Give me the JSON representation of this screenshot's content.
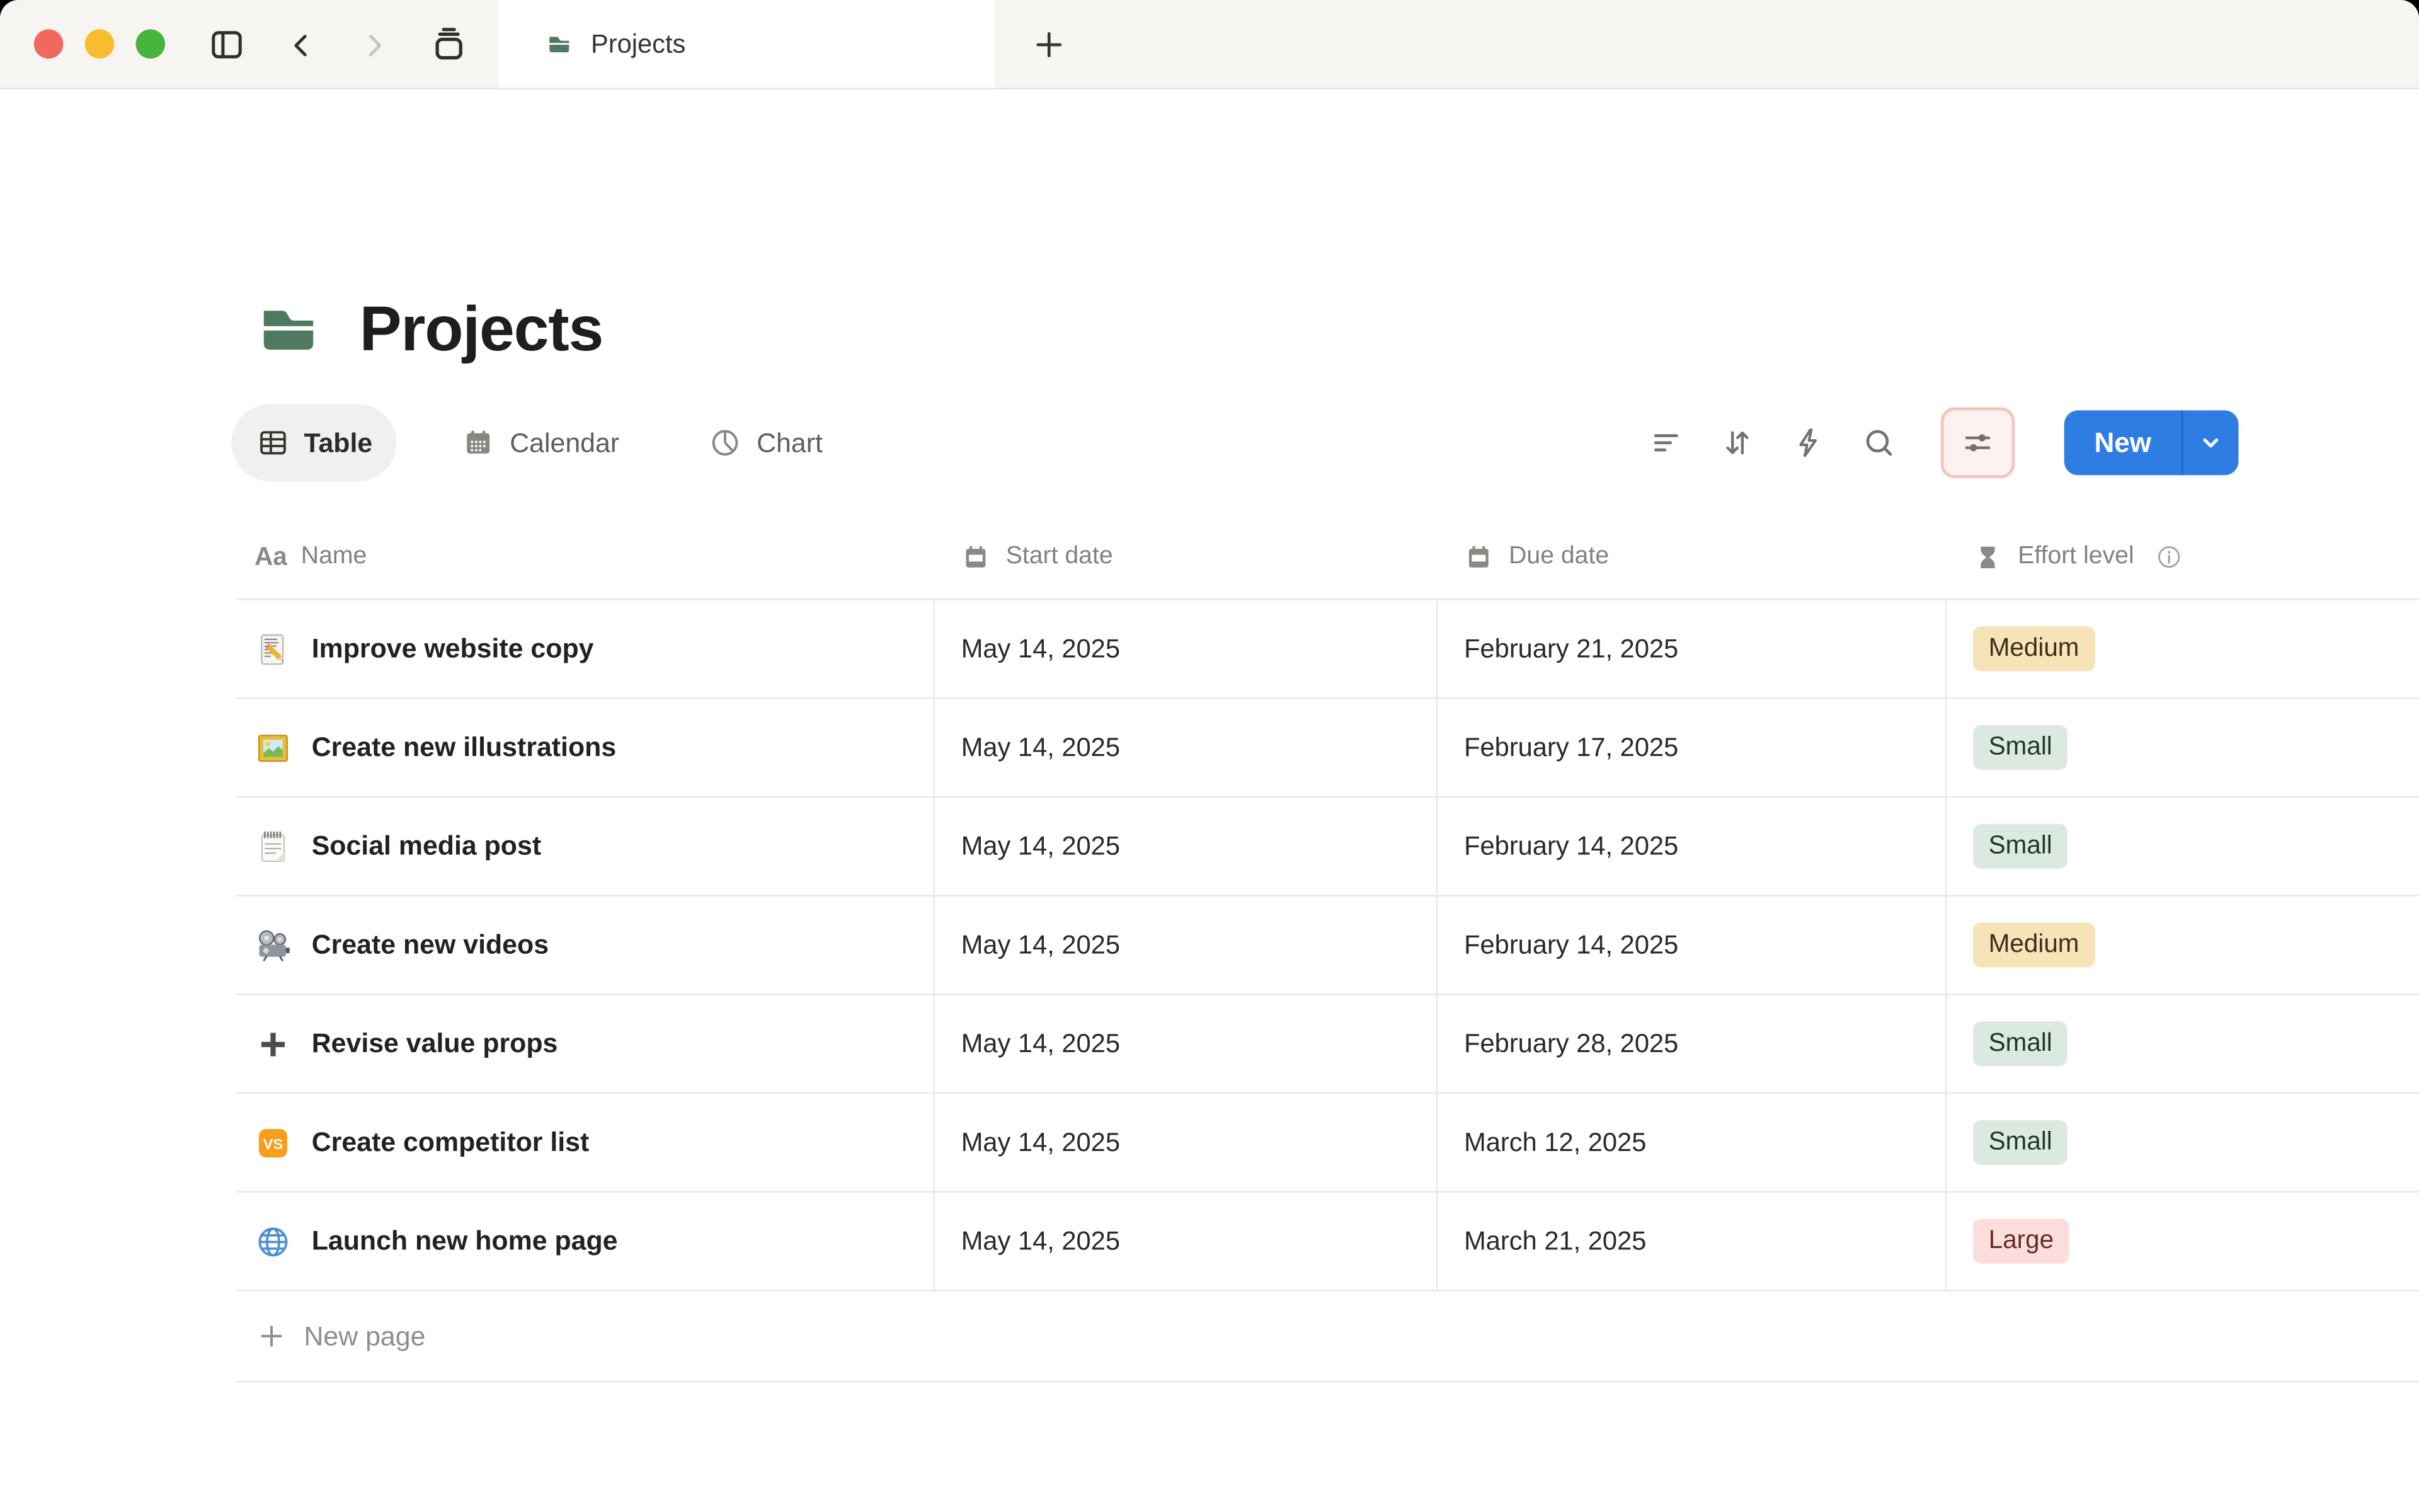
{
  "titlebar": {
    "tab_title": "Projects",
    "icons": [
      "sidebar-toggle-icon",
      "back-icon",
      "forward-icon",
      "tab-stack-icon",
      "new-tab-icon"
    ]
  },
  "page": {
    "title": "Projects",
    "icon": "folder-icon"
  },
  "views": [
    {
      "label": "Table",
      "icon": "table-icon",
      "active": true
    },
    {
      "label": "Calendar",
      "icon": "calendar-icon",
      "active": false
    },
    {
      "label": "Chart",
      "icon": "pie-chart-icon",
      "active": false
    }
  ],
  "toolbar": {
    "icons": [
      "filter-icon",
      "sort-icon",
      "automation-icon",
      "search-icon",
      "settings-sliders-icon"
    ],
    "highlighted_icon": "settings-sliders-icon",
    "new_button": {
      "label": "New",
      "has_dropdown": true
    }
  },
  "table": {
    "columns": [
      {
        "label": "Name",
        "icon": "text-icon"
      },
      {
        "label": "Start date",
        "icon": "calendar-icon"
      },
      {
        "label": "Due date",
        "icon": "calendar-icon"
      },
      {
        "label": "Effort level",
        "icon": "hourglass-icon",
        "info": true
      }
    ],
    "rows": [
      {
        "icon": "memo",
        "name": "Improve website copy",
        "start": "May 14, 2025",
        "due": "February 21, 2025",
        "effort": "Medium"
      },
      {
        "icon": "framed-picture",
        "name": "Create new illustrations",
        "start": "May 14, 2025",
        "due": "February 17, 2025",
        "effort": "Small"
      },
      {
        "icon": "spiral-notepad",
        "name": "Social media post",
        "start": "May 14, 2025",
        "due": "February 14, 2025",
        "effort": "Small"
      },
      {
        "icon": "film-projector",
        "name": "Create new videos",
        "start": "May 14, 2025",
        "due": "February 14, 2025",
        "effort": "Medium"
      },
      {
        "icon": "plus",
        "name": "Revise value props",
        "start": "May 14, 2025",
        "due": "February 28, 2025",
        "effort": "Small"
      },
      {
        "icon": "vs",
        "name": "Create competitor list",
        "start": "May 14, 2025",
        "due": "March 12, 2025",
        "effort": "Small"
      },
      {
        "icon": "globe",
        "name": "Launch new home page",
        "start": "May 14, 2025",
        "due": "March 21, 2025",
        "effort": "Large"
      }
    ],
    "new_page_label": "New page"
  },
  "effort_levels": {
    "Small": {
      "bg": "#dce9e1",
      "text": "#1c3829"
    },
    "Medium": {
      "bg": "#f6e3b8",
      "text": "#3d2e1c"
    },
    "Large": {
      "bg": "#fbdedb",
      "text": "#6a2b24"
    }
  },
  "colors": {
    "accent_blue": "#2e7de2",
    "folder_green": "#4e7a5f",
    "highlight_bg": "#fdf2f0",
    "highlight_border": "#f4c5bf",
    "traffic_red": "#f2685c",
    "traffic_yellow": "#f8bd2e",
    "traffic_green": "#45b53e"
  }
}
